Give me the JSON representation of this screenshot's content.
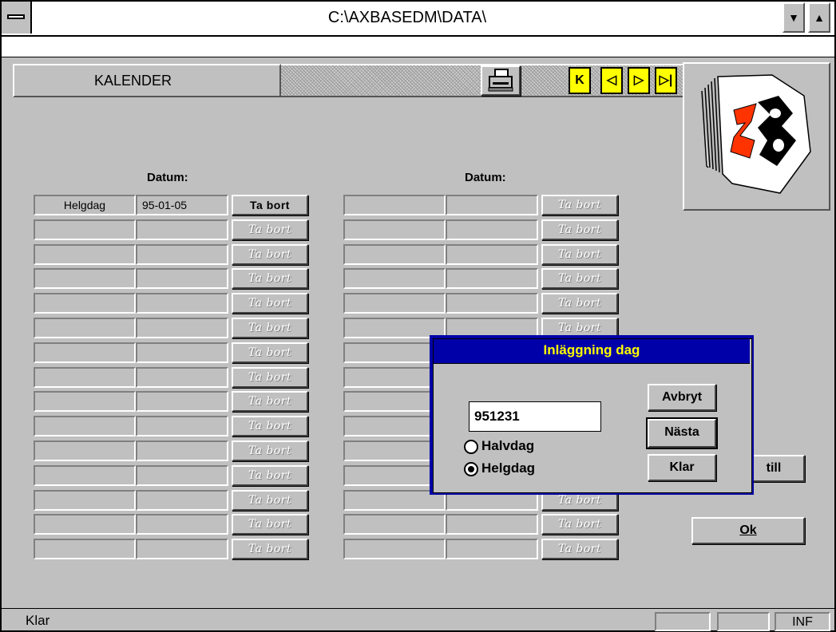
{
  "window": {
    "title": "C:\\AXBASEDM\\DATA\\"
  },
  "header": {
    "section_title": "KALENDER"
  },
  "toolbar": {
    "print_icon": "printer-icon",
    "nav": {
      "first": "K",
      "prev": "◁",
      "next": "▷",
      "last": "▷|"
    }
  },
  "left_list": {
    "datum_label": "Datum:",
    "rows": [
      {
        "type": "Helgdag",
        "date": "95-01-05",
        "action": "Ta bort"
      },
      {
        "type": "",
        "date": "",
        "action": "Ta bort"
      },
      {
        "type": "",
        "date": "",
        "action": "Ta bort"
      },
      {
        "type": "",
        "date": "",
        "action": "Ta bort"
      },
      {
        "type": "",
        "date": "",
        "action": "Ta bort"
      },
      {
        "type": "",
        "date": "",
        "action": "Ta bort"
      },
      {
        "type": "",
        "date": "",
        "action": "Ta bort"
      },
      {
        "type": "",
        "date": "",
        "action": "Ta bort"
      },
      {
        "type": "",
        "date": "",
        "action": "Ta bort"
      },
      {
        "type": "",
        "date": "",
        "action": "Ta bort"
      },
      {
        "type": "",
        "date": "",
        "action": "Ta bort"
      },
      {
        "type": "",
        "date": "",
        "action": "Ta bort"
      },
      {
        "type": "",
        "date": "",
        "action": "Ta bort"
      },
      {
        "type": "",
        "date": "",
        "action": "Ta bort"
      },
      {
        "type": "",
        "date": "",
        "action": "Ta bort"
      }
    ]
  },
  "right_list": {
    "datum_label": "Datum:",
    "action": "Ta bort"
  },
  "side_buttons": {
    "add_partial": "till",
    "ok": "Ok"
  },
  "dialog": {
    "title": "Inläggning dag",
    "date_value": "951231",
    "option_half": "Halvdag",
    "option_full": "Helgdag",
    "selected": "Helgdag",
    "cancel": "Avbryt",
    "next": "Nästa",
    "done": "Klar"
  },
  "status": {
    "text": "Klar",
    "panel_inf": "INF"
  },
  "colors": {
    "dialog_title_bg": "#0000a8",
    "dialog_title_fg": "#ffff00",
    "nav_button": "#ffff00"
  }
}
